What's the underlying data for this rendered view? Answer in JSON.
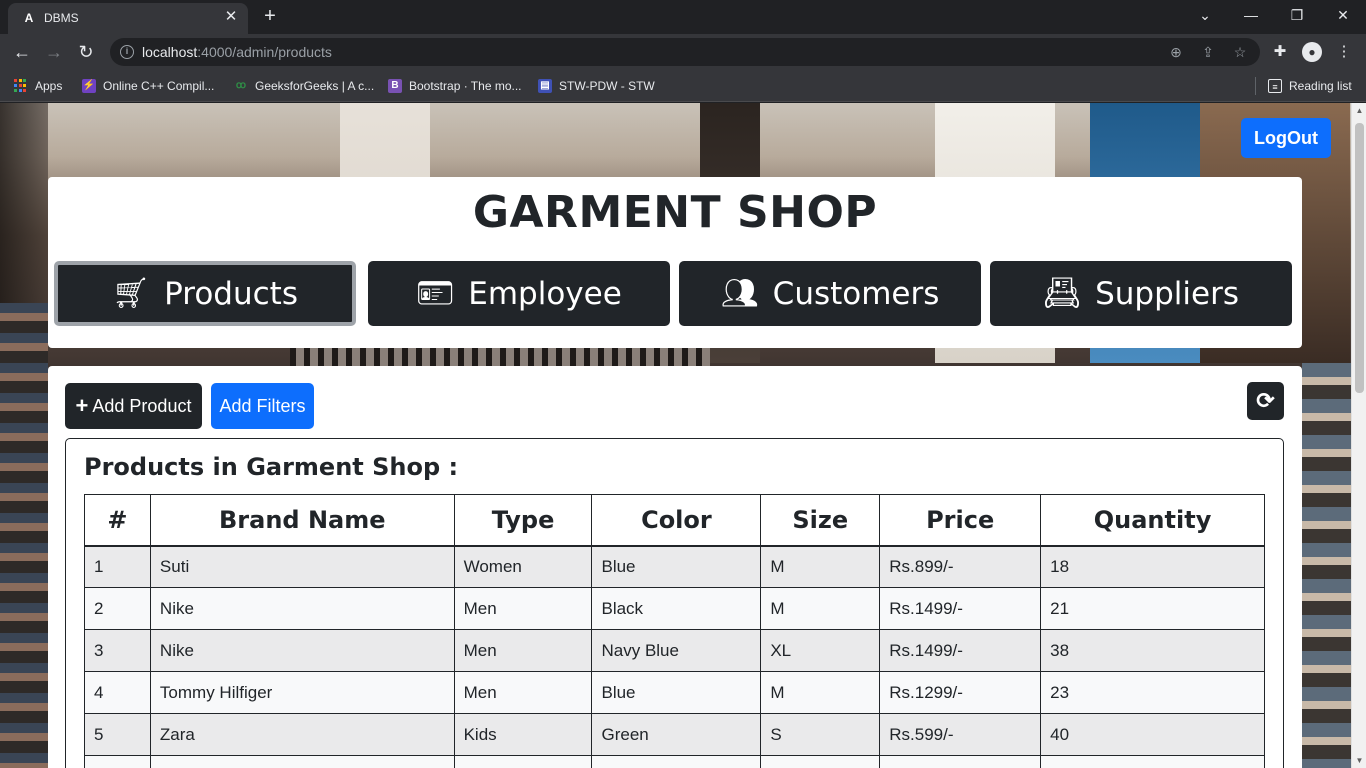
{
  "browser": {
    "tab_title": "DBMS",
    "url_host": "localhost",
    "url_rest": ":4000/admin/products",
    "bookmarks": [
      {
        "label": "Apps"
      },
      {
        "label": "Online C++ Compil..."
      },
      {
        "label": "GeeksforGeeks | A c..."
      },
      {
        "label": "Bootstrap · The mo..."
      },
      {
        "label": "STW-PDW - STW"
      }
    ],
    "reading_list": "Reading list"
  },
  "page": {
    "logout_label": "LogOut",
    "shop_title": "GARMENT SHOP",
    "nav": [
      {
        "label": "Products",
        "icon": "cart-icon"
      },
      {
        "label": "Employee",
        "icon": "id-card-icon"
      },
      {
        "label": "Customers",
        "icon": "users-icon"
      },
      {
        "label": "Suppliers",
        "icon": "address-book-icon"
      }
    ],
    "add_product_label": "Add Product",
    "add_filters_label": "Add Filters",
    "table_heading": "Products in Garment Shop :",
    "columns": [
      "#",
      "Brand Name",
      "Type",
      "Color",
      "Size",
      "Price",
      "Quantity"
    ],
    "rows": [
      [
        "1",
        "Suti",
        "Women",
        "Blue",
        "M",
        "Rs.899/-",
        "18"
      ],
      [
        "2",
        "Nike",
        "Men",
        "Black",
        "M",
        "Rs.1499/-",
        "21"
      ],
      [
        "3",
        "Nike",
        "Men",
        "Navy Blue",
        "XL",
        "Rs.1499/-",
        "38"
      ],
      [
        "4",
        "Tommy Hilfiger",
        "Men",
        "Blue",
        "M",
        "Rs.1299/-",
        "23"
      ],
      [
        "5",
        "Zara",
        "Kids",
        "Green",
        "S",
        "Rs.599/-",
        "40"
      ]
    ]
  },
  "colors": {
    "primary": "#0d6efd",
    "dark": "#212529"
  }
}
